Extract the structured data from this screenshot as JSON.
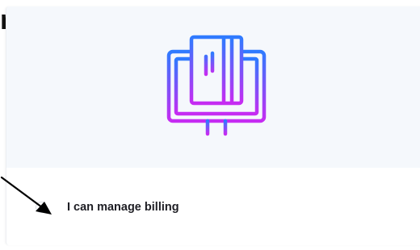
{
  "heading": {
    "fragment": "n,"
  },
  "illustration": {
    "icon": "billing-computer-icon",
    "gradient_start": "#2f7bff",
    "gradient_end": "#c62cf2"
  },
  "option": {
    "label": "I can manage billing",
    "selected": false
  },
  "annotation": {
    "icon": "pointer-arrow-icon",
    "color": "#000000"
  }
}
